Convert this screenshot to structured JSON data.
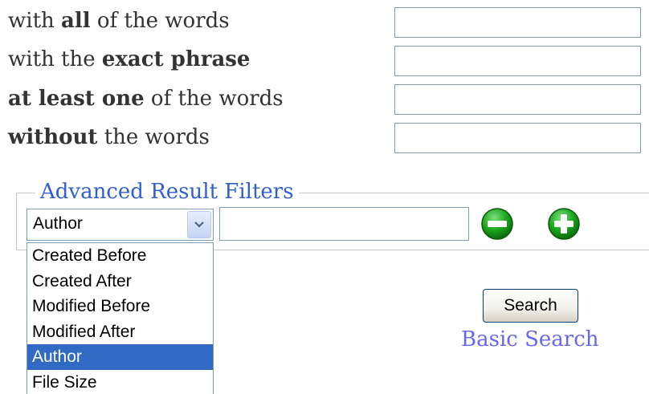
{
  "search_rows": [
    {
      "pre": "with ",
      "bold": "all",
      "post": " of the words",
      "value": ""
    },
    {
      "pre": "with the ",
      "bold": "exact phrase",
      "post": "",
      "value": ""
    },
    {
      "pre": "",
      "bold": "at least one",
      "post": " of the words",
      "value": ""
    },
    {
      "pre": "",
      "bold": "without",
      "post": " the words",
      "value": ""
    }
  ],
  "filters": {
    "legend": "Advanced Result Filters",
    "selected_field": "Author",
    "filter_value": "",
    "options": [
      "Created Before",
      "Created After",
      "Modified Before",
      "Modified After",
      "Author",
      "File Size"
    ],
    "selected_index": 4,
    "remove_icon": "minus-circle-icon",
    "add_icon": "plus-circle-icon"
  },
  "actions": {
    "search_label": "Search",
    "basic_search_label": "Basic Search"
  },
  "colors": {
    "legend": "#2f5fd0",
    "link": "#6666ee",
    "selection": "#316ac5",
    "icon_green": "#1fa81f"
  }
}
